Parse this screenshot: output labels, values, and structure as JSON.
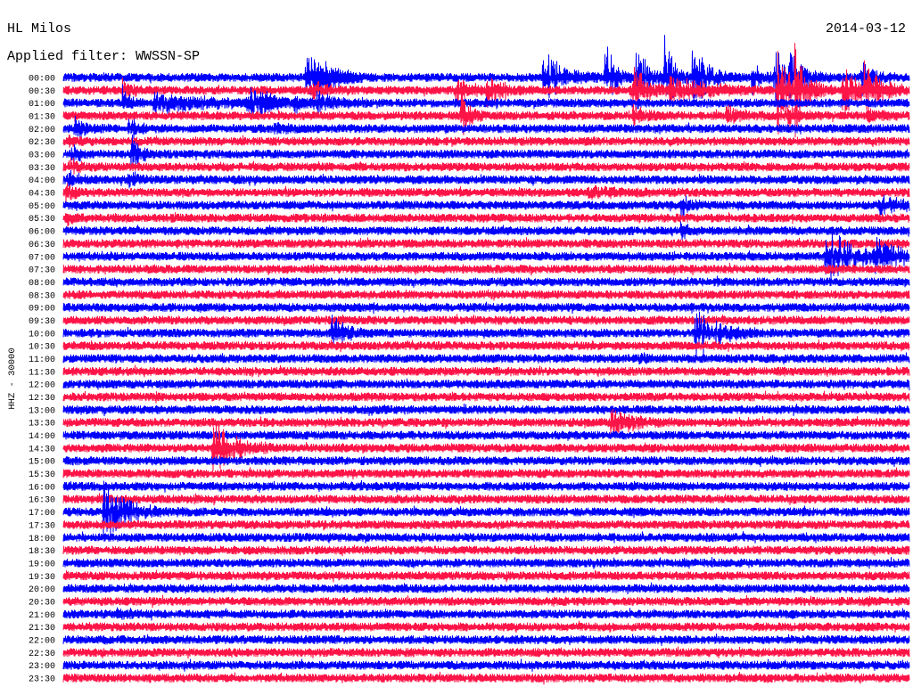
{
  "chart_data": {
    "type": "line",
    "title": "HL Milos",
    "subtitle": "Applied filter: WWSSN-SP",
    "date": "2014-03-12",
    "xlabel": "",
    "ylabel": "HHZ - 30000",
    "xlim": [
      0,
      30
    ],
    "grid": false,
    "legend": "none",
    "trace_colors": [
      "#0000ff",
      "#ff1448"
    ],
    "rows": [
      "00:00",
      "00:30",
      "01:00",
      "01:30",
      "02:00",
      "02:30",
      "03:00",
      "03:30",
      "04:00",
      "04:30",
      "05:00",
      "05:30",
      "06:00",
      "06:30",
      "07:00",
      "07:30",
      "08:00",
      "08:30",
      "09:00",
      "09:30",
      "10:00",
      "10:30",
      "11:00",
      "11:30",
      "12:00",
      "12:30",
      "13:00",
      "13:30",
      "14:00",
      "14:30",
      "15:00",
      "15:30",
      "16:00",
      "16:30",
      "17:00",
      "17:30",
      "18:00",
      "18:30",
      "19:00",
      "19:30",
      "20:00",
      "20:30",
      "21:00",
      "21:30",
      "22:00",
      "22:30",
      "23:00",
      "23:30"
    ],
    "events": [
      {
        "row": "00:00",
        "minute": 8.6,
        "amplitude": 9,
        "duration": 0.4
      },
      {
        "row": "00:00",
        "minute": 8.9,
        "amplitude": 8,
        "duration": 0.5
      },
      {
        "row": "00:00",
        "minute": 9.3,
        "amplitude": 5,
        "duration": 0.4
      },
      {
        "row": "00:00",
        "minute": 10.0,
        "amplitude": 3,
        "duration": 0.3
      },
      {
        "row": "00:00",
        "minute": 17.0,
        "amplitude": 8,
        "duration": 0.6
      },
      {
        "row": "00:00",
        "minute": 19.2,
        "amplitude": 10,
        "duration": 0.3
      },
      {
        "row": "00:00",
        "minute": 20.3,
        "amplitude": 9,
        "duration": 0.4
      },
      {
        "row": "00:00",
        "minute": 21.3,
        "amplitude": 13,
        "duration": 0.3
      },
      {
        "row": "00:00",
        "minute": 22.3,
        "amplitude": 9,
        "duration": 0.5
      },
      {
        "row": "00:00",
        "minute": 24.4,
        "amplitude": 5,
        "duration": 0.3
      },
      {
        "row": "00:00",
        "minute": 25.2,
        "amplitude": 8,
        "duration": 0.4
      },
      {
        "row": "00:00",
        "minute": 25.7,
        "amplitude": 7,
        "duration": 0.5
      },
      {
        "row": "00:00",
        "minute": 28.3,
        "amplitude": 5,
        "duration": 0.4
      },
      {
        "row": "00:30",
        "minute": 2.1,
        "amplitude": 4,
        "duration": 0.3
      },
      {
        "row": "00:30",
        "minute": 8.8,
        "amplitude": 3,
        "duration": 0.5
      },
      {
        "row": "00:30",
        "minute": 13.9,
        "amplitude": 4,
        "duration": 0.5
      },
      {
        "row": "00:30",
        "minute": 15.0,
        "amplitude": 5,
        "duration": 0.6
      },
      {
        "row": "00:30",
        "minute": 20.1,
        "amplitude": 8,
        "duration": 0.5
      },
      {
        "row": "00:30",
        "minute": 21.5,
        "amplitude": 4,
        "duration": 1.4
      },
      {
        "row": "00:30",
        "minute": 25.3,
        "amplitude": 12,
        "duration": 0.4
      },
      {
        "row": "00:30",
        "minute": 25.9,
        "amplitude": 14,
        "duration": 0.4
      },
      {
        "row": "00:30",
        "minute": 27.6,
        "amplitude": 7,
        "duration": 0.6
      },
      {
        "row": "00:30",
        "minute": 28.4,
        "amplitude": 8,
        "duration": 0.5
      },
      {
        "row": "01:00",
        "minute": 2.1,
        "amplitude": 5,
        "duration": 0.2
      },
      {
        "row": "01:00",
        "minute": 3.2,
        "amplitude": 3,
        "duration": 2.0
      },
      {
        "row": "01:00",
        "minute": 6.5,
        "amplitude": 5,
        "duration": 0.7
      },
      {
        "row": "01:00",
        "minute": 7.0,
        "amplitude": 5,
        "duration": 0.4
      },
      {
        "row": "01:00",
        "minute": 8.2,
        "amplitude": 3,
        "duration": 0.4
      },
      {
        "row": "01:00",
        "minute": 9.0,
        "amplitude": 4,
        "duration": 0.5
      },
      {
        "row": "01:30",
        "minute": 14.1,
        "amplitude": 6,
        "duration": 0.3
      },
      {
        "row": "01:30",
        "minute": 20.2,
        "amplitude": 3,
        "duration": 0.5
      },
      {
        "row": "01:30",
        "minute": 23.5,
        "amplitude": 3,
        "duration": 0.6
      },
      {
        "row": "01:30",
        "minute": 25.6,
        "amplitude": 4,
        "duration": 0.4
      },
      {
        "row": "01:30",
        "minute": 28.5,
        "amplitude": 3,
        "duration": 0.4
      },
      {
        "row": "02:00",
        "minute": 0.4,
        "amplitude": 4,
        "duration": 0.3
      },
      {
        "row": "02:00",
        "minute": 2.3,
        "amplitude": 4,
        "duration": 0.3
      },
      {
        "row": "02:00",
        "minute": 7.5,
        "amplitude": 2.5,
        "duration": 0.3
      },
      {
        "row": "02:30",
        "minute": 0.2,
        "amplitude": 2,
        "duration": 0.3
      },
      {
        "row": "03:00",
        "minute": 0.3,
        "amplitude": 3,
        "duration": 0.3
      },
      {
        "row": "03:00",
        "minute": 2.4,
        "amplitude": 6,
        "duration": 0.3
      },
      {
        "row": "03:30",
        "minute": 0.2,
        "amplitude": 3,
        "duration": 0.3
      },
      {
        "row": "04:00",
        "minute": 0.2,
        "amplitude": 3,
        "duration": 0.3
      },
      {
        "row": "04:00",
        "minute": 2.3,
        "amplitude": 3,
        "duration": 0.3
      },
      {
        "row": "04:30",
        "minute": 0.1,
        "amplitude": 3,
        "duration": 0.3
      },
      {
        "row": "04:30",
        "minute": 18.6,
        "amplitude": 2.2,
        "duration": 1.3
      },
      {
        "row": "05:00",
        "minute": 21.9,
        "amplitude": 4,
        "duration": 0.3
      },
      {
        "row": "05:00",
        "minute": 28.9,
        "amplitude": 3,
        "duration": 0.9
      },
      {
        "row": "05:30",
        "minute": 0.1,
        "amplitude": 3,
        "duration": 0.3
      },
      {
        "row": "06:00",
        "minute": 21.9,
        "amplitude": 3,
        "duration": 0.3
      },
      {
        "row": "07:00",
        "minute": 27.0,
        "amplitude": 8,
        "duration": 0.9
      },
      {
        "row": "07:00",
        "minute": 28.7,
        "amplitude": 6,
        "duration": 0.8
      },
      {
        "row": "10:00",
        "minute": 9.5,
        "amplitude": 5,
        "duration": 0.5
      },
      {
        "row": "10:00",
        "minute": 22.4,
        "amplitude": 7,
        "duration": 0.8
      },
      {
        "row": "11:00",
        "minute": 20.4,
        "amplitude": 2,
        "duration": 0.3
      },
      {
        "row": "13:30",
        "minute": 19.4,
        "amplitude": 4,
        "duration": 0.8
      },
      {
        "row": "14:30",
        "minute": 5.3,
        "amplitude": 7,
        "duration": 0.8
      },
      {
        "row": "17:00",
        "minute": 1.4,
        "amplitude": 8,
        "duration": 0.8
      },
      {
        "row": "20:30",
        "minute": 28.4,
        "amplitude": 2,
        "duration": 0.3
      },
      {
        "row": "21:00",
        "minute": 1.9,
        "amplitude": 1.8,
        "duration": 0.4
      }
    ]
  }
}
